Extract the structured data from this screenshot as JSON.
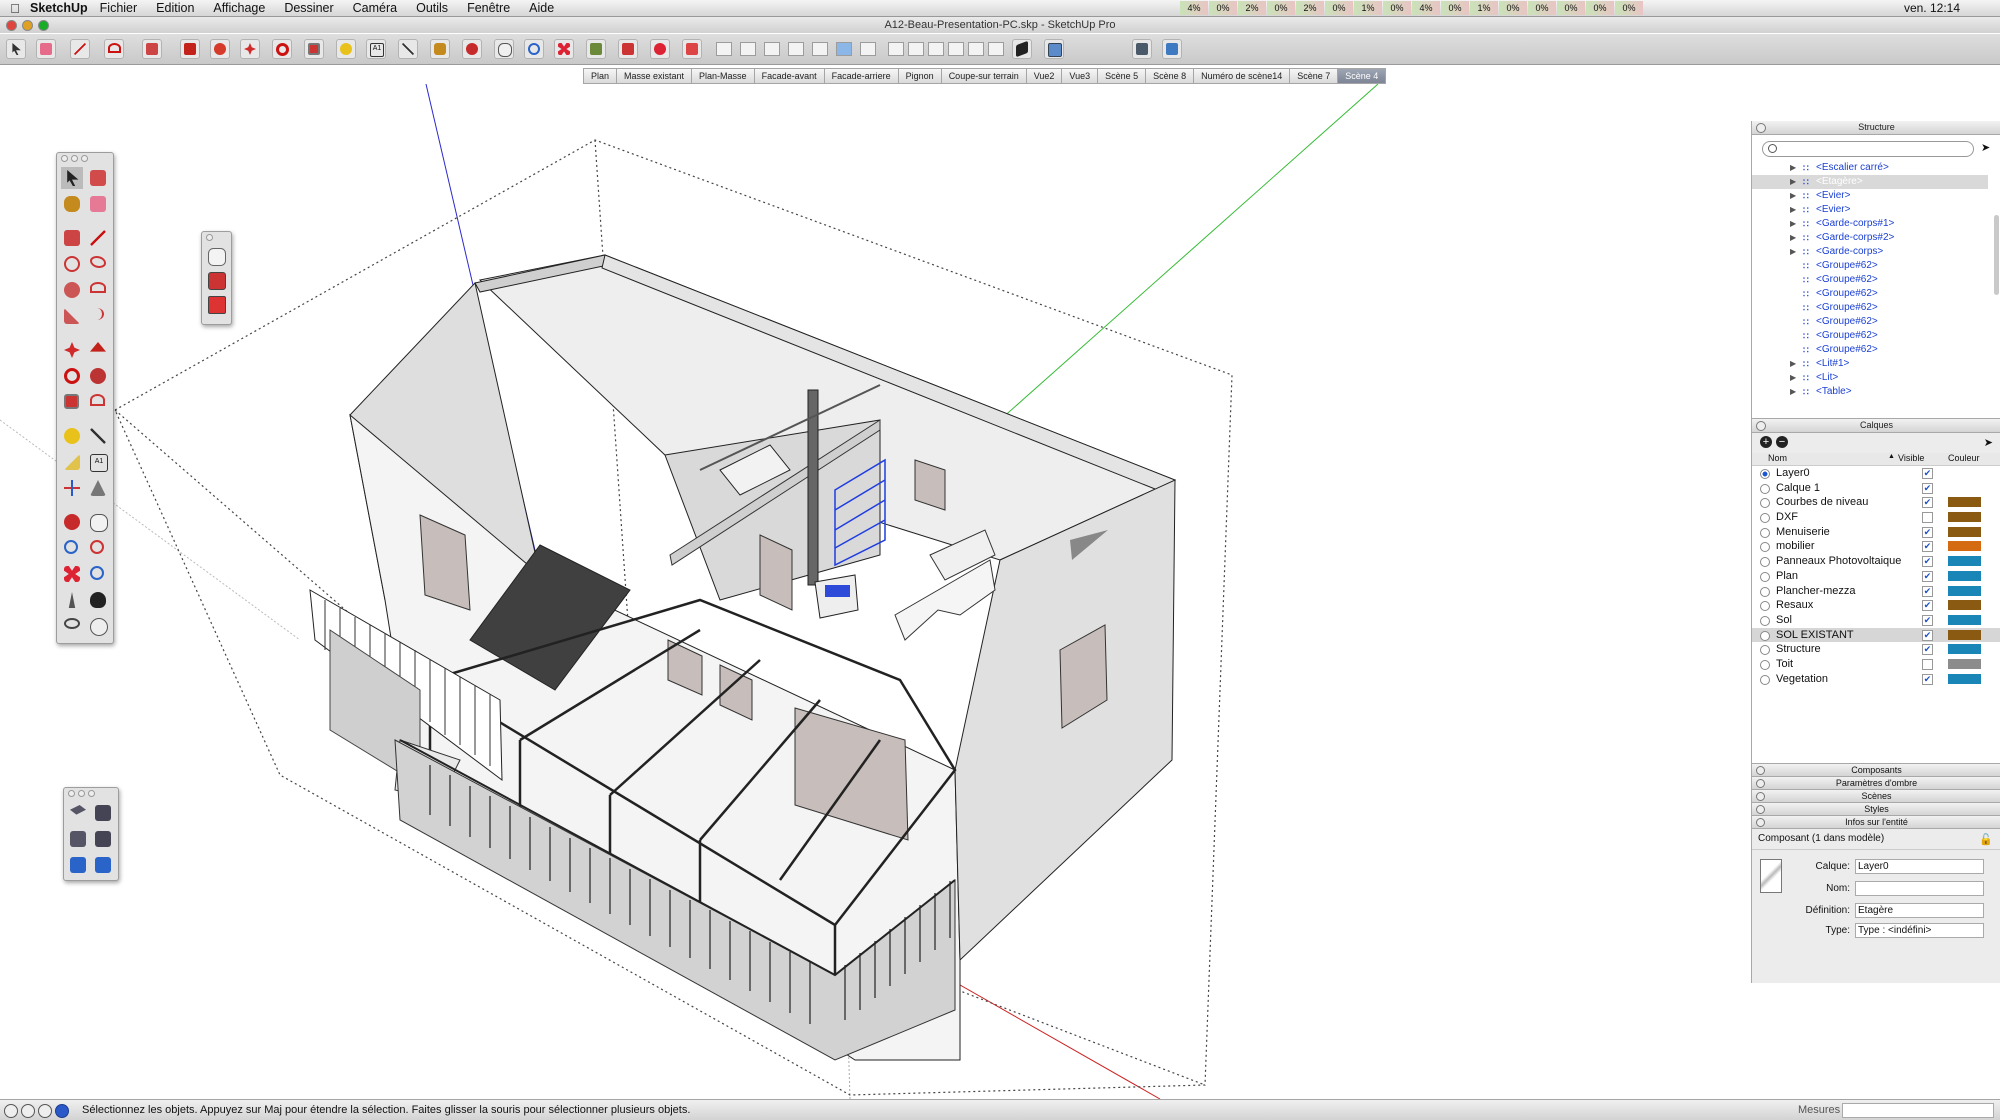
{
  "menubar": {
    "app_name": "SketchUp",
    "menus": [
      "Fichier",
      "Edition",
      "Affichage",
      "Dessiner",
      "Caméra",
      "Outils",
      "Fenêtre",
      "Aide"
    ],
    "status_readouts": [
      "4%",
      "0%",
      "2%",
      "0%",
      "2%",
      "0%",
      "1%",
      "0%",
      "4%",
      "0%",
      "1%",
      "0%",
      "0%",
      "0%",
      "0%",
      "0%"
    ],
    "clock": "ven. 12:14"
  },
  "window": {
    "title": "A12-Beau-Presentation-PC.skp - SketchUp Pro"
  },
  "scenes": {
    "tabs": [
      "Plan",
      "Masse existant",
      "Plan-Masse",
      "Facade-avant",
      "Facade-arriere",
      "Pignon",
      "Coupe-sur terrain",
      "Vue2",
      "Vue3",
      "Scène 5",
      "Scène 8",
      "Numéro de scène14",
      "Scène 7",
      "Scène 4"
    ],
    "active": "Scène 4"
  },
  "structure": {
    "title": "Structure",
    "items": [
      {
        "label": "<Escalier carré>",
        "expandable": true,
        "selected": false
      },
      {
        "label": "<Etagère>",
        "expandable": true,
        "selected": true
      },
      {
        "label": "<Evier>",
        "expandable": true,
        "selected": false
      },
      {
        "label": "<Evier>",
        "expandable": true,
        "selected": false
      },
      {
        "label": "<Garde-corps#1>",
        "expandable": true,
        "selected": false
      },
      {
        "label": "<Garde-corps#2>",
        "expandable": true,
        "selected": false
      },
      {
        "label": "<Garde-corps>",
        "expandable": true,
        "selected": false
      },
      {
        "label": "<Groupe#62>",
        "expandable": false,
        "selected": false
      },
      {
        "label": "<Groupe#62>",
        "expandable": false,
        "selected": false
      },
      {
        "label": "<Groupe#62>",
        "expandable": false,
        "selected": false
      },
      {
        "label": "<Groupe#62>",
        "expandable": false,
        "selected": false
      },
      {
        "label": "<Groupe#62>",
        "expandable": false,
        "selected": false
      },
      {
        "label": "<Groupe#62>",
        "expandable": false,
        "selected": false
      },
      {
        "label": "<Groupe#62>",
        "expandable": false,
        "selected": false
      },
      {
        "label": "<Lit#1>",
        "expandable": true,
        "selected": false
      },
      {
        "label": "<Lit>",
        "expandable": true,
        "selected": false
      },
      {
        "label": "<Table>",
        "expandable": true,
        "selected": false
      }
    ]
  },
  "layers": {
    "title": "Calques",
    "col_name": "Nom",
    "col_visible": "Visible",
    "col_color": "Couleur",
    "rows": [
      {
        "name": "Layer0",
        "active": true,
        "visible": true,
        "color": "#ffffff"
      },
      {
        "name": "Calque 1",
        "active": false,
        "visible": true,
        "color": "#ffffff"
      },
      {
        "name": "Courbes de niveau",
        "active": false,
        "visible": true,
        "color": "#8a5a12"
      },
      {
        "name": "DXF",
        "active": false,
        "visible": false,
        "color": "#8a5a12"
      },
      {
        "name": "Menuiserie",
        "active": false,
        "visible": true,
        "color": "#8a5a12"
      },
      {
        "name": "mobilier",
        "active": false,
        "visible": true,
        "color": "#d46a12"
      },
      {
        "name": "Panneaux Photovoltaique",
        "active": false,
        "visible": true,
        "color": "#1a86b8"
      },
      {
        "name": "Plan",
        "active": false,
        "visible": true,
        "color": "#1a86b8"
      },
      {
        "name": "Plancher-mezza",
        "active": false,
        "visible": true,
        "color": "#1a86b8"
      },
      {
        "name": "Resaux",
        "active": false,
        "visible": true,
        "color": "#8a5a12"
      },
      {
        "name": "Sol",
        "active": false,
        "visible": true,
        "color": "#1a86b8"
      },
      {
        "name": "SOL EXISTANT",
        "active": false,
        "visible": true,
        "color": "#8a5a12",
        "selected": true
      },
      {
        "name": "Structure",
        "active": false,
        "visible": true,
        "color": "#1a86b8"
      },
      {
        "name": "Toit",
        "active": false,
        "visible": false,
        "color": "#8c8c8c"
      },
      {
        "name": "Vegetation",
        "active": false,
        "visible": true,
        "color": "#1a86b8"
      }
    ]
  },
  "collapsed_panels": [
    "Composants",
    "Paramètres d'ombre",
    "Scènes",
    "Styles",
    "Infos sur l'entité"
  ],
  "entity_info": {
    "header": "Composant (1 dans modèle)",
    "layer_label": "Calque:",
    "layer_value": "Layer0",
    "name_label": "Nom:",
    "name_value": "",
    "definition_label": "Définition:",
    "definition_value": "Etagère",
    "type_label": "Type:",
    "type_value": "Type : <indéfini>"
  },
  "statusbar": {
    "message": "Sélectionnez les objets. Appuyez sur Maj pour étendre la sélection. Faites glisser la souris pour sélectionner plusieurs objets.",
    "measure_label": "Mesures",
    "measure_value": ""
  }
}
